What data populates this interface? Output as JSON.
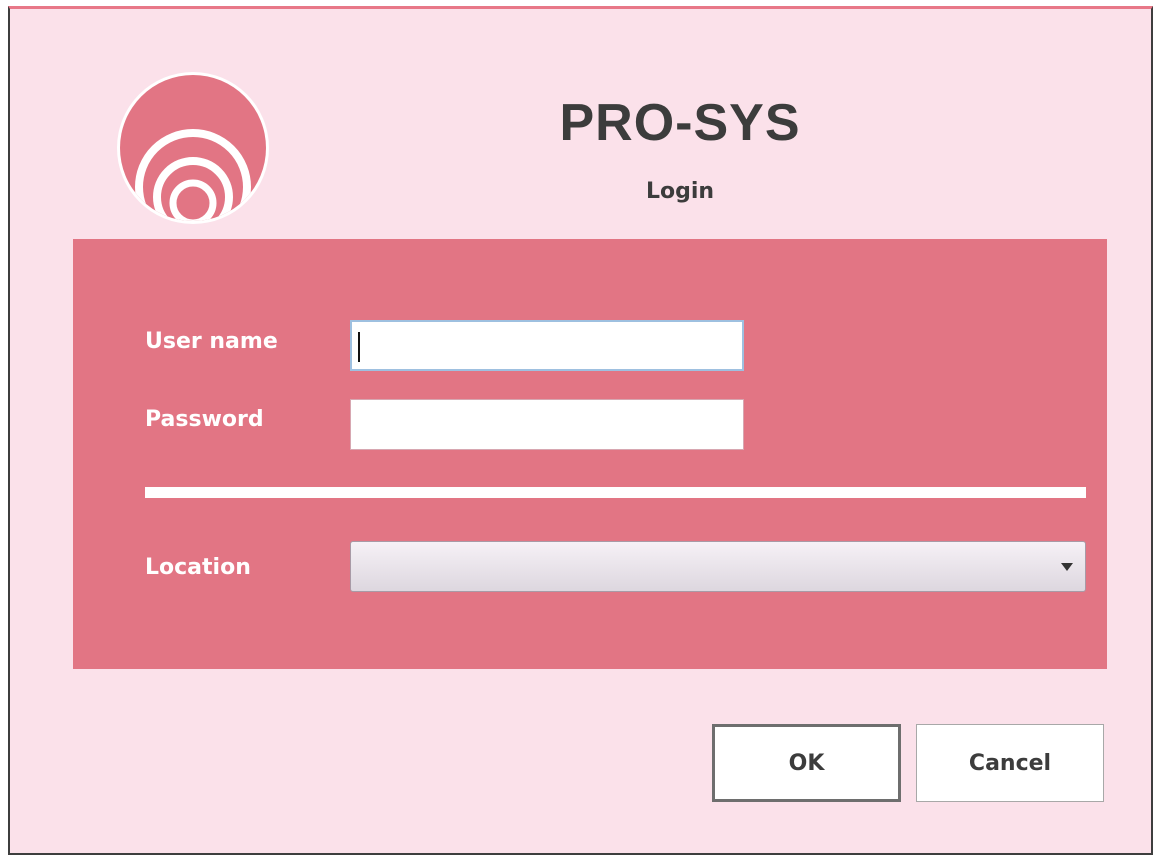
{
  "app": {
    "title": "PRO-SYS",
    "subtitle": "Login"
  },
  "form": {
    "username_label": "User name",
    "username_value": "",
    "password_label": "Password",
    "password_value": "",
    "location_label": "Location",
    "location_value": ""
  },
  "buttons": {
    "ok_label": "OK",
    "cancel_label": "Cancel"
  },
  "colors": {
    "window_bg": "#fbe1ea",
    "panel_bg": "#e27584",
    "title_text": "#3c3c3c"
  },
  "icons": {
    "logo": "concentric-circles-logo",
    "dropdown": "chevron-down-icon"
  }
}
